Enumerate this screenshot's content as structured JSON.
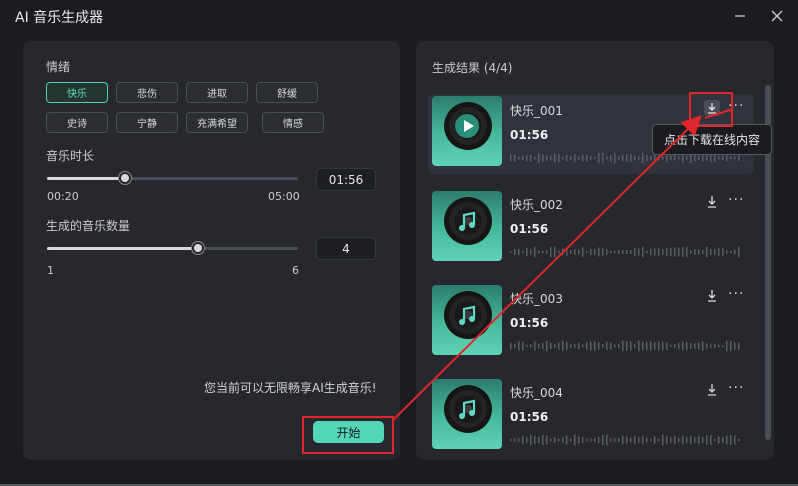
{
  "window": {
    "title": "AI 音乐生成器"
  },
  "left": {
    "mood_label": "情绪",
    "moods": [
      "快乐",
      "悲伤",
      "进取",
      "舒缓",
      "史诗",
      "宁静",
      "充满希望",
      "情感"
    ],
    "active_mood": "快乐",
    "duration": {
      "label": "音乐时长",
      "min_label": "00:20",
      "max_label": "05:00",
      "value": "01:56",
      "fraction": 0.31
    },
    "count": {
      "label": "生成的音乐数量",
      "min_label": "1",
      "max_label": "6",
      "value": "4",
      "fraction": 0.6
    },
    "note": "您当前可以无限畅享AI生成音乐!",
    "start_label": "开始"
  },
  "right": {
    "title": "生成结果 (4/4)",
    "tooltip": "点击下载在线内容",
    "tracks": [
      {
        "name": "快乐_001",
        "duration": "01:56",
        "icon": "play-icon"
      },
      {
        "name": "快乐_002",
        "duration": "01:56",
        "icon": "music-note-icon"
      },
      {
        "name": "快乐_003",
        "duration": "01:56",
        "icon": "music-note-icon"
      },
      {
        "name": "快乐_004",
        "duration": "01:56",
        "icon": "music-note-icon"
      }
    ]
  },
  "colors": {
    "accent": "#52d6b4",
    "annotation": "#e0262b"
  }
}
